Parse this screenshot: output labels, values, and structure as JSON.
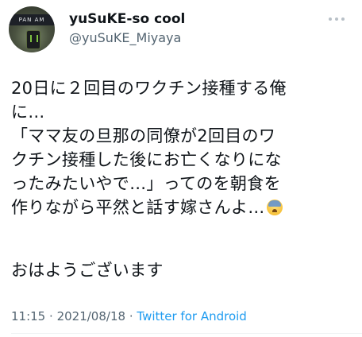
{
  "tweet": {
    "author": {
      "display_name": "yuSuKE-so cool",
      "handle": "@yuSuKE_Miyaya",
      "avatar_text": "PAN AM"
    },
    "more_icon": "more-horizontal-icon",
    "text": "20日に２回目のワクチン接種する俺\nに…\n「ママ友の旦那の同僚が2回目のワ\nクチン接種した後にお亡くなりにな\nったみたいやで…」ってのを朝食を\n作りながら平然と話す嫁さんよ…",
    "emoji": "anxious-face-with-sweat-emoji",
    "greeting": "おはようございます",
    "meta": {
      "time": "11:15",
      "separator": "·",
      "date": "2021/08/18",
      "source": "Twitter for Android"
    }
  },
  "colors": {
    "text": "#0f1419",
    "secondary": "#536471",
    "link": "#1d9bf0",
    "background": "#ffffff"
  }
}
